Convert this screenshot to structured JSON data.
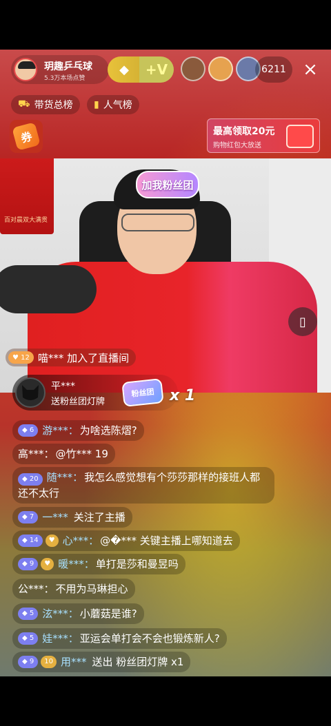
{
  "anchor": {
    "name": "玥趣乒乓球",
    "likes": "5.3万本场点赞"
  },
  "top_badges": {
    "plus_label": "+V"
  },
  "viewer_count": "6211",
  "close_icon": "×",
  "pills": {
    "sales_rank": "带货总榜",
    "popularity_rank": "人气榜"
  },
  "coupon": {
    "label": "券"
  },
  "redpack": {
    "title": "最高领取20元",
    "subtitle": "购物红包大放送"
  },
  "video": {
    "poster_text": "百对晨双大满贯",
    "fan_sticker": "加我粉丝团"
  },
  "join_notice": {
    "level": "12",
    "text": "喵*** 加入了直播间"
  },
  "gift_banner": {
    "name": "平***",
    "desc": "送粉丝团灯牌",
    "gift_label": "粉丝团",
    "count": "x 1"
  },
  "chat": [
    {
      "level": "6",
      "user": "游***：",
      "text": "为啥选陈熠?"
    },
    {
      "level": "",
      "user": "高***：",
      "text": "@竹*** 19"
    },
    {
      "level": "20",
      "user": "随***：",
      "text": "我怎么感觉想有个莎莎那样的接班人都还不太行"
    },
    {
      "level": "7",
      "user": "一***",
      "text": "关注了主播"
    },
    {
      "level": "14",
      "fan": "♥",
      "user": "心***：",
      "text": "@�*** 关键主播上哪知道去"
    },
    {
      "level": "9",
      "fan": "♥",
      "user": "暖***：",
      "text": "单打是莎和曼昱吗"
    },
    {
      "level": "",
      "user": "公***：",
      "text": "不用为马琳担心"
    },
    {
      "level": "5",
      "user": "泫***：",
      "text": "小蘑菇是谁?"
    },
    {
      "level": "5",
      "user": "娃***：",
      "text": "亚运会单打会不会也锻炼新人?"
    },
    {
      "level": "9",
      "fan": "10",
      "user": "用***",
      "text": "送出 粉丝团灯牌 x1"
    }
  ]
}
